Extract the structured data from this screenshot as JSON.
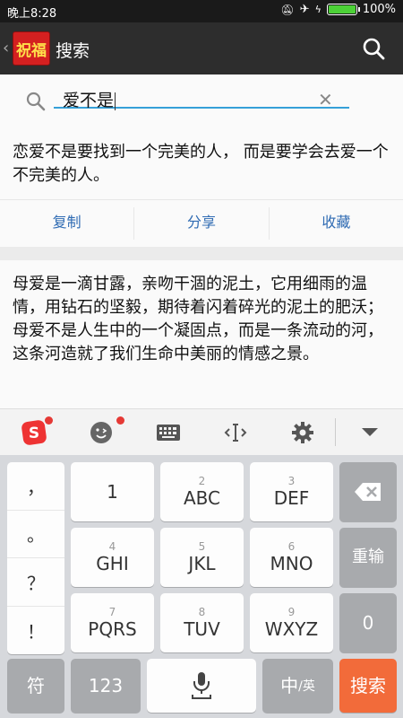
{
  "status_bar": {
    "time": "晚上8:28",
    "battery": "100%",
    "battery_level": 1.0
  },
  "app_bar": {
    "logo_text": "祝福",
    "title": "搜索"
  },
  "search": {
    "query": "爱不是"
  },
  "results": [
    {
      "text": "恋爱不是要找到一个完美的人， 而是要学会去爱一个不完美的人。",
      "actions": [
        "复制",
        "分享",
        "收藏"
      ]
    },
    {
      "text": "母爱是一滴甘露，亲吻干涸的泥土，它用细雨的温情，用钻石的坚毅，期待着闪着碎光的泥土的肥沃；母爱不是人生中的一个凝固点，而是一条流动的河，这条河造就了我们生命中美丽的情感之景。"
    }
  ],
  "keyboard": {
    "punctuation": [
      "，",
      "。",
      "？",
      "！"
    ],
    "keys": [
      {
        "num": "",
        "label": "1"
      },
      {
        "num": "2",
        "label": "ABC"
      },
      {
        "num": "3",
        "label": "DEF"
      },
      {
        "num": "4",
        "label": "GHI"
      },
      {
        "num": "5",
        "label": "JKL"
      },
      {
        "num": "6",
        "label": "MNO"
      },
      {
        "num": "7",
        "label": "PQRS"
      },
      {
        "num": "8",
        "label": "TUV"
      },
      {
        "num": "9",
        "label": "WXYZ"
      }
    ],
    "reenter": "重输",
    "zero": "0",
    "symbol": "符",
    "num_mode": "123",
    "lang_main": "中",
    "lang_alt": "/英",
    "search": "搜索"
  },
  "colors": {
    "accent": "#35a0d8",
    "action_text": "#2f6bb3",
    "search_key": "#f26b3a",
    "logo_bg": "#d42020"
  }
}
